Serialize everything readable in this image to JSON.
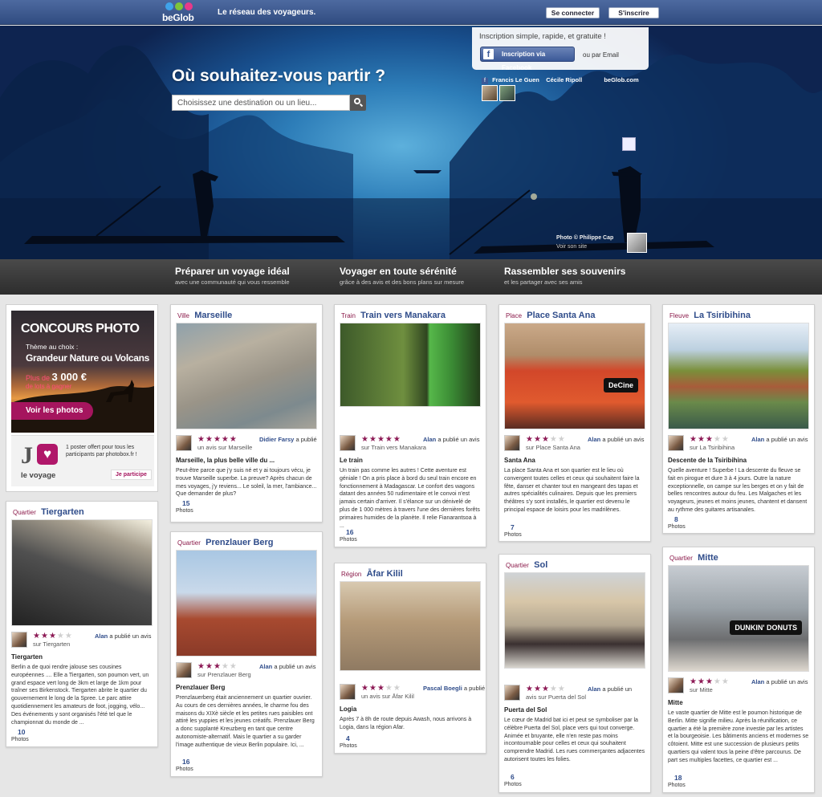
{
  "topbar": {
    "logo": "beGlob",
    "tagline": "Le réseau des voyageurs.",
    "login": "Se connecter",
    "signup": "S'inscrire"
  },
  "hero": {
    "title": "Où souhaitez-vous partir ?",
    "search_placeholder": "Choisissez une destination ou un lieu...",
    "signup_text": "Inscription simple, rapide, et gratuite !",
    "facebook_button": "Inscription via Facebook",
    "email_link": "ou par Email",
    "friend1": "Francis Le Guen",
    "friend2": "Cécile Ripoll",
    "friends_site": "beGlob.com",
    "photo_credit": "Photo © Philippe Cap",
    "photo_site": "Voir son site"
  },
  "features": [
    {
      "title": "Préparer un voyage idéal",
      "sub": "avec une communauté qui vous ressemble"
    },
    {
      "title": "Voyager en toute sérénité",
      "sub": "grâce à des avis et des bons plans sur mesure"
    },
    {
      "title": "Rassembler ses souvenirs",
      "sub": "et les partager avec ses amis"
    }
  ],
  "concours": {
    "title": "CONCOURS PHOTO",
    "theme": "Thème au choix :",
    "theme2": "Grandeur Nature ou Volcans",
    "prize_prefix": "Plus de",
    "prize_amount": "3 000 €",
    "prize_suffix": "de lots à gagner",
    "button": "Voir les photos",
    "logo_j": "J",
    "logo_text": "le voyage",
    "desc": "1 poster offert pour tous les participants par photobox.fr !",
    "link": "Je participe"
  },
  "cards": [
    {
      "type": "Ville",
      "name": "Marseille",
      "author": "Didier Farsy",
      "action": "a publié",
      "action2": "un avis sur Marseille",
      "rating": 5,
      "title": "Marseille, la plus belle ville du ...",
      "text": "Peut-être parce que j'y suis né et y ai toujours vécu, je trouve Marseille superbe. La preuve? Après chacun de mes voyages, j'y reviens... Le soleil, la mer, l'ambiance... Que demander de plus?",
      "count": "15",
      "count_label": "Photos"
    },
    {
      "type": "Train",
      "name": "Train vers Manakara",
      "author": "Alan",
      "action": "a publié un avis",
      "action2": "sur Train vers Manakara",
      "rating": 5,
      "title": "Le train",
      "text": "Un train pas comme les autres ! Cette aventure est géniale ! On a pris place à bord du seul train encore en fonctionnement à Madagascar. Le confort des wagons datant des années 50 rudimentaire et le convoi n'est jamais certain d'arriver. Il s'élance sur un dénivelé de plus de 1 000 mètres à travers l'une des dernières forêts primaires humides de la planète. Il relie Fianarantsoa à ...",
      "count": "16",
      "count_label": "Photos"
    },
    {
      "type": "Place",
      "name": "Place Santa Ana",
      "author": "Alan",
      "action": "a publié un avis",
      "action2": "sur Place Santa Ana",
      "rating": 3,
      "title": "Santa Ana",
      "text": "La place Santa Ana et son quartier est le lieu où convergent toutes celles et ceux qui souhaitent faire la fête, danser et chanter tout en mangeant des tapas et autres spécialités culinaires. Depuis que les premiers théâtres s'y sont installés, le quartier est devenu le principal espace de loisirs pour les madrilènes.",
      "count": "7",
      "count_label": "Photos",
      "sign": "DeCine"
    },
    {
      "type": "Fleuve",
      "name": "La Tsiribihina",
      "author": "Alan",
      "action": "a publié un avis",
      "action2": "sur La Tsiribihina",
      "rating": 3,
      "title": "Descente de la Tsiribihina",
      "text": "Quelle aventure ! Superbe ! La descente du fleuve se fait en pirogue et dure 3 à 4 jours. Outre la nature exceptionnelle, on campe sur les berges et on y fait de belles rencontres autour du feu. Les Malgaches et les voyageurs, jeunes et moins jeunes, chantent et dansent au rythme des guitares artisanales.",
      "count": "8",
      "count_label": "Photos"
    },
    {
      "type": "Quartier",
      "name": "Tiergarten",
      "author": "Alan",
      "action": "a publié un avis",
      "action2": "sur Tiergarten",
      "rating": 3,
      "title": "Tiergarten",
      "text": "Berlin a de quoi rendre jalouse ses cousines européennes .... Elle a Tiergarten, son poumon vert, un grand espace vert long de 3km et large de 1km pour traîner ses Birkenstock. Tiergarten abrite le quartier du gouvernement le long de la Spree. Le parc attire quotidiennement les amateurs de foot, jogging, vélo... Des événements y sont organisés l'été tel que le championnat du monde de ...",
      "count": "10",
      "count_label": "Photos"
    },
    {
      "type": "Quartier",
      "name": "Prenzlauer Berg",
      "author": "Alan",
      "action": "a publié un avis",
      "action2": "sur Prenzlauer Berg",
      "rating": 3,
      "title": "Prenzlauer Berg",
      "text": "Prenzlauerberg était anciennement un quartier ouvrier. Au cours de ces dernières années, le charme fou des maisons du XIXè siècle et les petites rues paisibles ont attiré les yuppies et les jeunes créatifs. Prenzlauer Berg a donc supplanté Kreuzberg en tant que centre autonomiste-alternatif. Mais le quartier a su garder l'image authentique de vieux Berlin populaire. Ici, ...",
      "count": "16",
      "count_label": "Photos"
    },
    {
      "type": "Région",
      "name": "Āfar Kilil",
      "author": "Pascal Boegli",
      "action": "a publié",
      "action2": "un avis sur Āfar Kilil",
      "rating": 3,
      "title": "Logia",
      "text": "Après 7 à 8h de route depuis Awash, nous arrivons à Logia, dans la région Afar.",
      "count": "4",
      "count_label": "Photos"
    },
    {
      "type": "Quartier",
      "name": "Sol",
      "author": "Alan",
      "action": "a publié un",
      "action2": "avis sur Puerta del Sol",
      "rating": 3,
      "title": "Puerta del Sol",
      "text": "Le cœur de Madrid bat ici et peut se symboliser par la célèbre Puerta del Sol, place vers qui tout converge. Animée et bruyante, elle n'en reste pas moins incontournable pour celles et ceux qui souhaitent comprendre Madrid. Les rues commerçantes adjacentes autorisent toutes les folies.",
      "count": "6",
      "count_label": "Photos"
    },
    {
      "type": "Quartier",
      "name": "Mitte",
      "author": "Alan",
      "action": "a publié un avis",
      "action2": "sur Mitte",
      "rating": 3,
      "title": "Mitte",
      "text": "Le vaste quartier de Mitte est le poumon historique de Berlin. Mitte signifie milieu. Après la réunification, ce quartier a été la première zone investie par les artistes et la bourgeoisie. Les bâtiments anciens et modernes se côtoient. Mitte est une succession de plusieurs petits quartiers qui valent tous la peine d'être parcourus. De part ses multiples facettes, ce quartier est ...",
      "count": "18",
      "count_label": "Photos",
      "sign": "DUNKIN' DONUTS"
    }
  ]
}
